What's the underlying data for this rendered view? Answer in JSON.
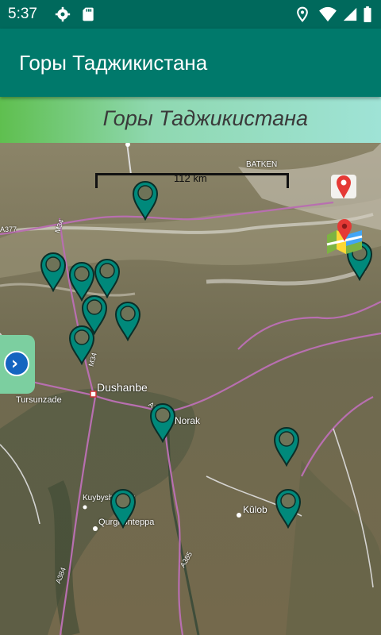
{
  "status_bar": {
    "time": "5:37",
    "icons": [
      "settings-icon",
      "sd-card-icon",
      "location-icon",
      "wifi-icon",
      "signal-icon",
      "battery-icon"
    ]
  },
  "app_bar": {
    "title": "Горы Таджикистана"
  },
  "banner": {
    "title": "Горы Таджикистана"
  },
  "map": {
    "scale_label": "112 km",
    "places": {
      "dushanbe": "Dushanbe",
      "tursunzade": "Tursunzade",
      "norak": "Norak",
      "kulob": "Kŭlob",
      "kuybyshevskiy": "Kuybyshevskiy",
      "qurgonteppa": "Qurghonteppa",
      "batken": "BATKEN"
    },
    "roads": {
      "m34": "M34",
      "a377": "A377",
      "m34b": "M34",
      "a385": "A385",
      "a384": "A384",
      "a385b": "A385"
    },
    "marker_count": 13
  },
  "colors": {
    "primary": "#00796b",
    "primary_dark": "#00695c",
    "marker": "#00897b"
  }
}
